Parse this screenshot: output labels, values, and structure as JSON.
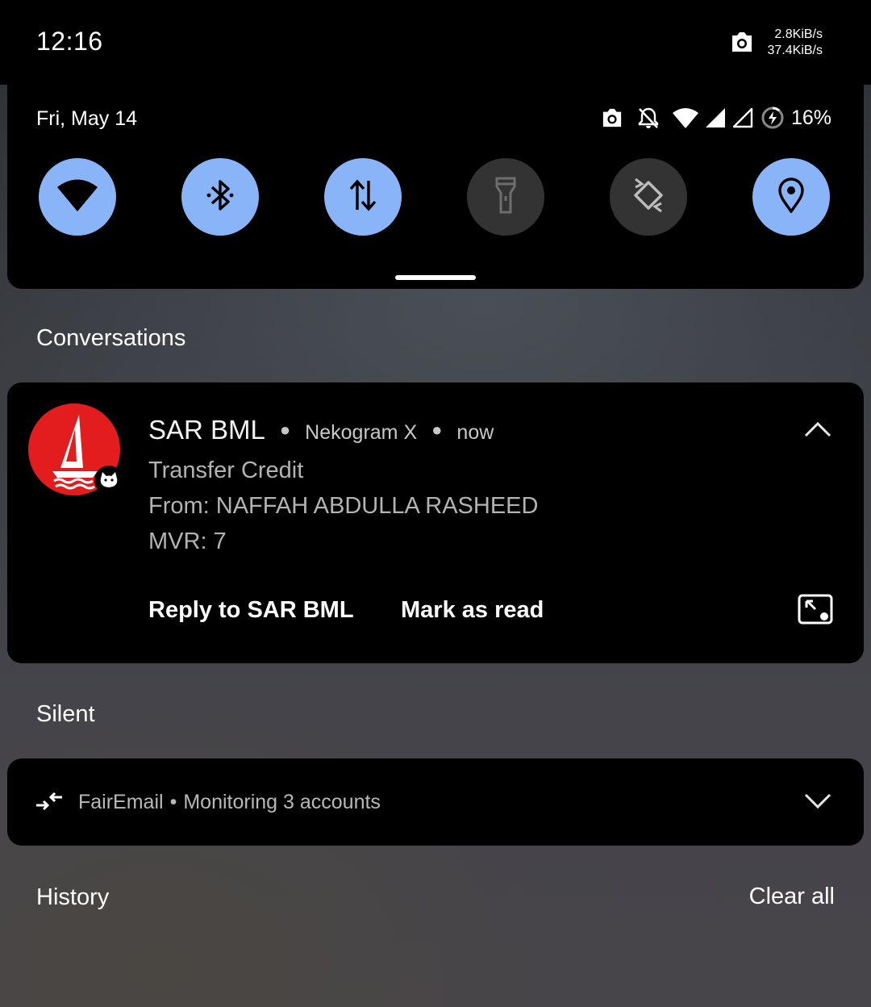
{
  "status_bar": {
    "time": "12:16",
    "net_up": "2.8KiB/s",
    "net_down": "37.4KiB/s",
    "icons": [
      "screenshot-icon"
    ]
  },
  "quick_settings": {
    "date": "Fri, May 14",
    "status_icons": [
      "screenshot-icon",
      "bell-off-icon",
      "wifi-icon",
      "cellular-signal-icon",
      "cellular-signal-icon",
      "battery-saver-icon"
    ],
    "battery_percent": "16%",
    "tiles": [
      {
        "name": "wifi",
        "icon": "wifi-icon",
        "on": true
      },
      {
        "name": "bluetooth",
        "icon": "bluetooth-icon",
        "on": true
      },
      {
        "name": "mobile-data",
        "icon": "data-arrows-icon",
        "on": true
      },
      {
        "name": "flashlight",
        "icon": "flashlight-icon",
        "on": false
      },
      {
        "name": "auto-rotate",
        "icon": "rotate-icon",
        "on": false
      },
      {
        "name": "location",
        "icon": "location-pin-icon",
        "on": true
      }
    ],
    "colors": {
      "tile_on": "#8ab4f8",
      "tile_off": "#333333"
    }
  },
  "sections": {
    "conversations": "Conversations",
    "silent": "Silent",
    "history": "History",
    "clear_all": "Clear all"
  },
  "conversation": {
    "sender": "SAR BML",
    "app": "Nekogram X",
    "time": "now",
    "title": "Transfer Credit",
    "from_line": "From: NAFFAH ABDULLA RASHEED",
    "amount_line": "MVR: 7",
    "actions": {
      "reply": "Reply to SAR BML",
      "mark_read": "Mark as read"
    },
    "avatar_color": "#e31d1d"
  },
  "silent_notification": {
    "app": "FairEmail",
    "separator": "•",
    "text": "Monitoring 3 accounts"
  }
}
